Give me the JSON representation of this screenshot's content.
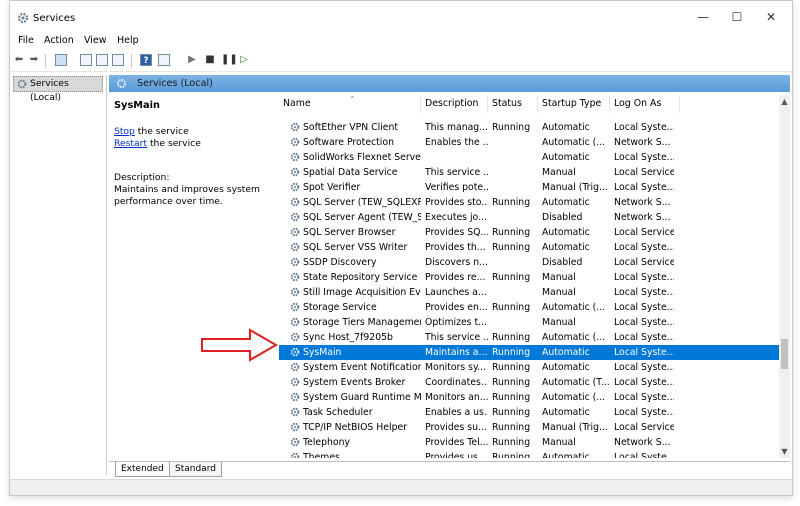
{
  "window": {
    "title": "Services"
  },
  "menu": [
    "File",
    "Action",
    "View",
    "Help"
  ],
  "tree": {
    "root": "Services (Local)"
  },
  "panel": {
    "title": "Services (Local)"
  },
  "extended": {
    "service_name": "SysMain",
    "stop_link": "Stop",
    "stop_suffix": " the service",
    "restart_link": "Restart",
    "restart_suffix": " the service",
    "description_label": "Description:",
    "description": "Maintains and improves system performance over time."
  },
  "columns": [
    "Name",
    "Description",
    "Status",
    "Startup Type",
    "Log On As"
  ],
  "rows": [
    {
      "name": "SoftEther VPN Client",
      "desc": "This manag...",
      "status": "Running",
      "startup": "Automatic",
      "logon": "Local Syste..."
    },
    {
      "name": "Software Protection",
      "desc": "Enables the ...",
      "status": "",
      "startup": "Automatic (...",
      "logon": "Network S..."
    },
    {
      "name": "SolidWorks Flexnet Server",
      "desc": "",
      "status": "",
      "startup": "Automatic",
      "logon": "Local Syste..."
    },
    {
      "name": "Spatial Data Service",
      "desc": "This service ...",
      "status": "",
      "startup": "Manual",
      "logon": "Local Service"
    },
    {
      "name": "Spot Verifier",
      "desc": "Verifies pote...",
      "status": "",
      "startup": "Manual (Trig...",
      "logon": "Local Syste..."
    },
    {
      "name": "SQL Server (TEW_SQLEXPRE...",
      "desc": "Provides sto...",
      "status": "Running",
      "startup": "Automatic",
      "logon": "Network S..."
    },
    {
      "name": "SQL Server Agent (TEW_SQL...",
      "desc": "Executes jo...",
      "status": "",
      "startup": "Disabled",
      "logon": "Network S..."
    },
    {
      "name": "SQL Server Browser",
      "desc": "Provides SQ...",
      "status": "Running",
      "startup": "Automatic",
      "logon": "Local Service"
    },
    {
      "name": "SQL Server VSS Writer",
      "desc": "Provides th...",
      "status": "Running",
      "startup": "Automatic",
      "logon": "Local Syste..."
    },
    {
      "name": "SSDP Discovery",
      "desc": "Discovers n...",
      "status": "",
      "startup": "Disabled",
      "logon": "Local Service"
    },
    {
      "name": "State Repository Service",
      "desc": "Provides re...",
      "status": "Running",
      "startup": "Manual",
      "logon": "Local Syste..."
    },
    {
      "name": "Still Image Acquisition Events",
      "desc": "Launches a...",
      "status": "",
      "startup": "Manual",
      "logon": "Local Syste..."
    },
    {
      "name": "Storage Service",
      "desc": "Provides en...",
      "status": "Running",
      "startup": "Automatic (...",
      "logon": "Local Syste..."
    },
    {
      "name": "Storage Tiers Management",
      "desc": "Optimizes t...",
      "status": "",
      "startup": "Manual",
      "logon": "Local Syste..."
    },
    {
      "name": "Sync Host_7f9205b",
      "desc": "This service ...",
      "status": "Running",
      "startup": "Automatic (...",
      "logon": "Local Syste..."
    },
    {
      "name": "SysMain",
      "desc": "Maintains a...",
      "status": "Running",
      "startup": "Automatic",
      "logon": "Local Syste...",
      "selected": true
    },
    {
      "name": "System Event Notification S...",
      "desc": "Monitors sy...",
      "status": "Running",
      "startup": "Automatic",
      "logon": "Local Syste..."
    },
    {
      "name": "System Events Broker",
      "desc": "Coordinates...",
      "status": "Running",
      "startup": "Automatic (T...",
      "logon": "Local Syste..."
    },
    {
      "name": "System Guard Runtime Mo...",
      "desc": "Monitors an...",
      "status": "Running",
      "startup": "Automatic (...",
      "logon": "Local Syste..."
    },
    {
      "name": "Task Scheduler",
      "desc": "Enables a us...",
      "status": "Running",
      "startup": "Automatic",
      "logon": "Local Syste..."
    },
    {
      "name": "TCP/IP NetBIOS Helper",
      "desc": "Provides su...",
      "status": "Running",
      "startup": "Manual (Trig...",
      "logon": "Local Service"
    },
    {
      "name": "Telephony",
      "desc": "Provides Tel...",
      "status": "Running",
      "startup": "Manual",
      "logon": "Network S..."
    },
    {
      "name": "Themes",
      "desc": "Provides us...",
      "status": "Running",
      "startup": "Automatic",
      "logon": "Local Syste..."
    }
  ],
  "tabs": [
    "Extended",
    "Standard"
  ],
  "colors": {
    "accent": "#0078d7",
    "header": "#5b9bd6",
    "link": "#0033cc",
    "arrow": "#e02020"
  }
}
